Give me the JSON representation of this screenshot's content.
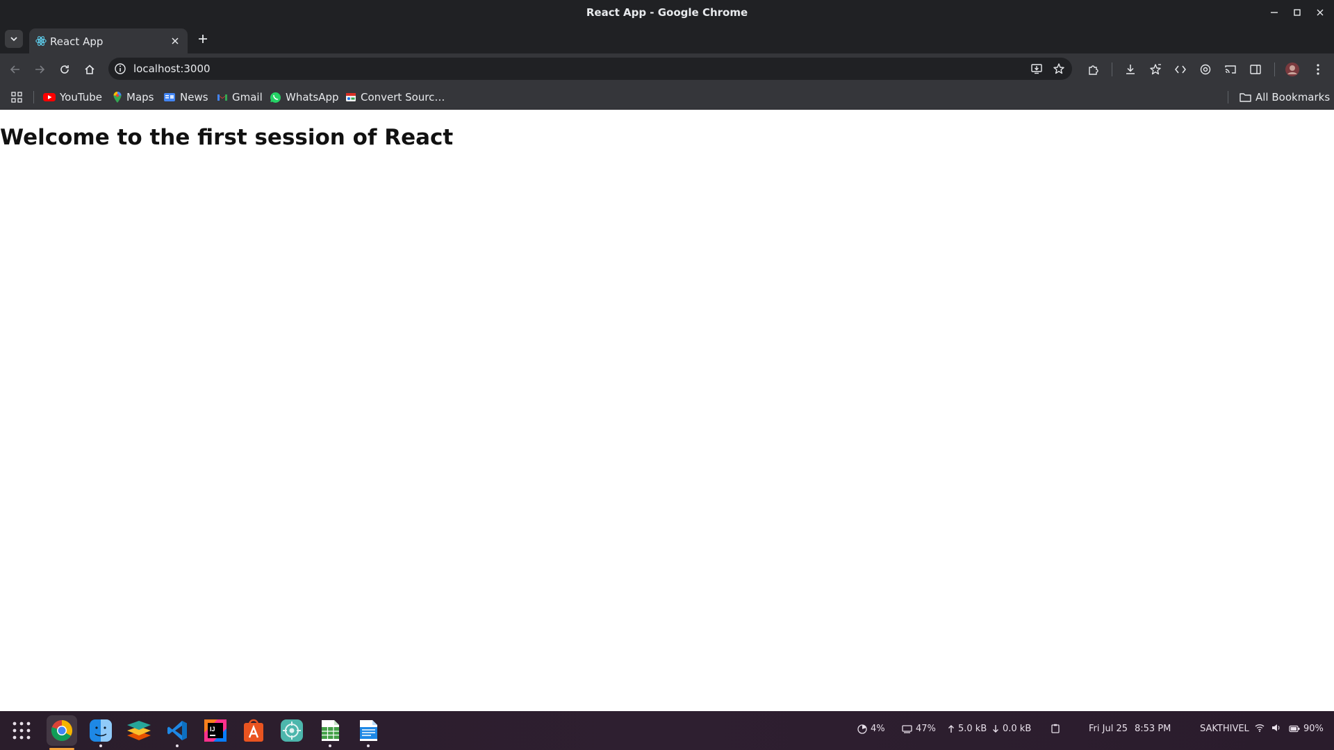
{
  "window": {
    "title": "React App - Google Chrome"
  },
  "tabs": [
    {
      "label": "React App",
      "favicon": "react-icon"
    }
  ],
  "toolbar": {
    "url": "localhost:3000"
  },
  "bookmarks": {
    "items": [
      {
        "label": "YouTube",
        "icon": "youtube-icon"
      },
      {
        "label": "Maps",
        "icon": "maps-icon"
      },
      {
        "label": "News",
        "icon": "news-icon"
      },
      {
        "label": "Gmail",
        "icon": "gmail-icon"
      },
      {
        "label": "WhatsApp",
        "icon": "whatsapp-icon"
      },
      {
        "label": "Convert Sourc…",
        "icon": "convert-icon"
      }
    ],
    "all_bookmarks": "All Bookmarks"
  },
  "page": {
    "heading": "Welcome to the first session of React"
  },
  "taskbar": {
    "apps": [
      "apps-grid-icon",
      "chrome-icon",
      "finder-icon",
      "layers-icon",
      "vscode-icon",
      "intellij-icon",
      "app-center-icon",
      "network-icon",
      "spreadsheet-icon",
      "document-icon"
    ],
    "cpu": "4%",
    "memory": "47%",
    "upload": "5.0 kB",
    "download": "0.0 kB",
    "date": "Fri Jul 25",
    "time": "8:53 PM",
    "user": "SAKTHIVEL",
    "battery": "90%"
  },
  "colors": {
    "titlebar": "#202124",
    "toolbar": "#35363a",
    "accent": "#f4a13b"
  }
}
